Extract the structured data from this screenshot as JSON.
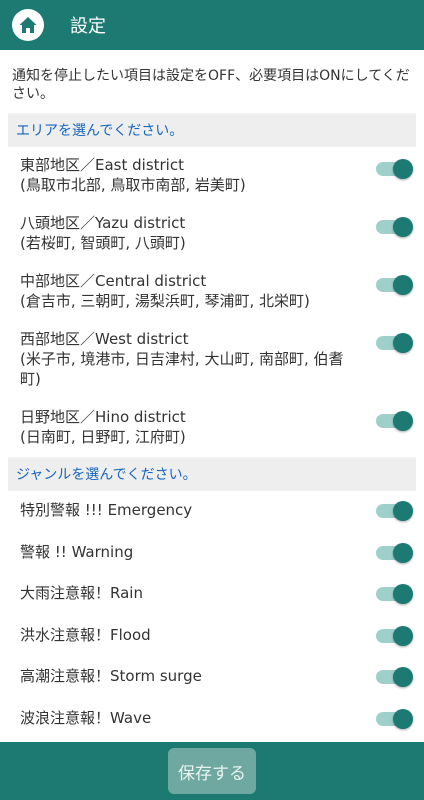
{
  "header": {
    "title": "設定",
    "home_icon": "home-icon"
  },
  "intro_text": "通知を停止したい項目は設定をOFF、必要項目はONにしてください。",
  "area_section": {
    "label": "エリアを選んでください。",
    "items": [
      {
        "name": "東部地区／East district",
        "sub": "(鳥取市北部, 鳥取市南部, 岩美町)",
        "on": true
      },
      {
        "name": "八頭地区／Yazu district",
        "sub": "(若桜町, 智頭町, 八頭町)",
        "on": true
      },
      {
        "name": "中部地区／Central district",
        "sub": "(倉吉市, 三朝町, 湯梨浜町, 琴浦町, 北栄町)",
        "on": true
      },
      {
        "name": "西部地区／West district",
        "sub": "(米子市, 境港市, 日吉津村, 大山町, 南部町, 伯耆町)",
        "on": true
      },
      {
        "name": "日野地区／Hino district",
        "sub": "(日南町, 日野町, 江府町)",
        "on": true
      }
    ]
  },
  "genre_section": {
    "label": "ジャンルを選んでください。",
    "items": [
      {
        "name": "特別警報 !!! Emergency",
        "on": true
      },
      {
        "name": "警報 !! Warning",
        "on": true
      },
      {
        "name": "大雨注意報！Rain",
        "on": true
      },
      {
        "name": "洪水注意報！Flood",
        "on": true
      },
      {
        "name": "高潮注意報！Storm surge",
        "on": true
      },
      {
        "name": "波浪注意報！Wave",
        "on": true
      }
    ]
  },
  "footer": {
    "save_label": "保存する"
  },
  "colors": {
    "primary": "#1c7a72",
    "toggle_track": "#9ed0cb",
    "section_text": "#1565c0"
  }
}
